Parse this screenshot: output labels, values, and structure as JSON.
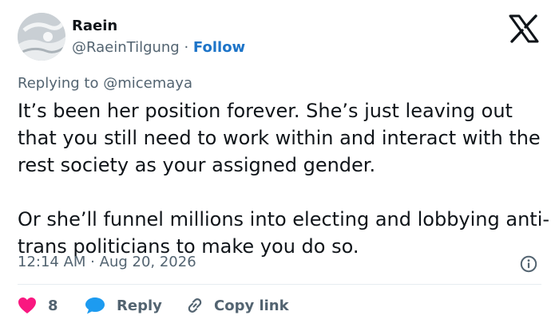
{
  "header": {
    "display_name": "Raein",
    "handle": "@RaeinTilgung",
    "separator": " · ",
    "follow_label": "Follow",
    "logo_icon": "x-logo-icon"
  },
  "tweet": {
    "replying_to_label": "Replying to",
    "replying_to_handle": "@micemaya",
    "paragraphs": [
      "It’s been her position forever. She’s just leaving out that you still need to work within and interact with the rest society as your assigned gender.",
      "Or she’ll funnel millions into electing and lobbying anti-trans politicians to make you do so."
    ],
    "time": "12:14 AM",
    "meta_separator": " · ",
    "date": "Aug 20, 2026",
    "info_icon": "info-icon"
  },
  "actions": {
    "like_count": "8",
    "reply_label": "Reply",
    "copy_link_label": "Copy link"
  },
  "colors": {
    "like": "#f91880",
    "reply": "#1d9bf0",
    "follow": "#1d74c8",
    "secondary_text": "#536471"
  }
}
